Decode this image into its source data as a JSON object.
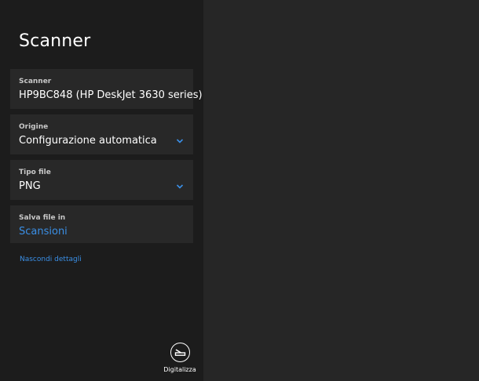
{
  "app": {
    "title": "Scanner"
  },
  "fields": [
    {
      "label": "Scanner",
      "value": "HP9BC848 (HP DeskJet 3630 series)"
    },
    {
      "label": "Origine",
      "value": "Configurazione automatica"
    },
    {
      "label": "Tipo file",
      "value": "PNG"
    },
    {
      "label": "Salva file in",
      "value": "Scansioni"
    }
  ],
  "details_link": "Nascondi dettagli",
  "scan_button": {
    "label": "Digitalizza",
    "icon": "scanner-icon"
  },
  "colors": {
    "accent": "#3a8fe6",
    "pane_bg": "#1c1c1c",
    "card_bg": "#282828",
    "preview_bg": "#262626"
  }
}
